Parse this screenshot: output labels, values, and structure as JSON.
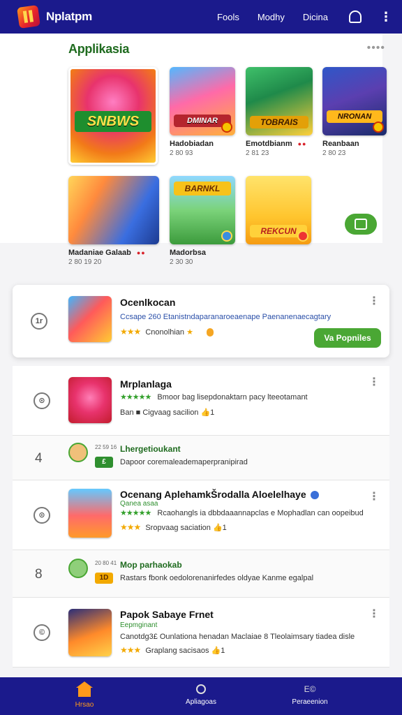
{
  "topbar": {
    "title": "Nplatpm",
    "nav": [
      "Fools",
      "Modhy",
      "Dicina"
    ],
    "logo_icon": "app-logo-icon",
    "bell_icon": "bell-icon",
    "menu_icon": "kebab-menu-icon"
  },
  "apps_section": {
    "title": "Applikasia",
    "more": "••••",
    "tiles": [
      {
        "art_text": "SNBWS",
        "name": "",
        "sub": ""
      },
      {
        "art_text": "DMINAR",
        "name": "Hadobiadan",
        "sub": "2 80 93"
      },
      {
        "art_text": "TOBRAIS",
        "name": "Emotdbianm",
        "sub": "2 81 23"
      },
      {
        "art_text": "NRONAN",
        "name": "Reanbaan",
        "sub": "2 80 23"
      },
      {
        "art_text": "",
        "name": "Madaniae Galaab",
        "sub": "2 80 19 20"
      },
      {
        "art_text": "BARNKL",
        "name": "Madorbsa",
        "sub": "2 30 30"
      },
      {
        "art_text": "REKCUN",
        "name": "",
        "sub": ""
      }
    ],
    "grab_icon": "download-box-icon"
  },
  "featured": {
    "rank": "1r",
    "title": "Ocenlkocan",
    "desc": "Ccsape 260 Etanistndaparanaroeaenape Paenanenaecagtary",
    "stars": "★★★",
    "rating_text": "Cnonolhian",
    "button": "Va Popniles"
  },
  "list": [
    {
      "rank": "⊙",
      "title": "Mrplanlaga",
      "stars": "★★★★★",
      "line1": "Bmoor bag lisepdonaktarn pacy lteeotamant",
      "line2": "Ban ■ Cigvaag sacilion 👍1"
    },
    {
      "rank": "4",
      "title": "Lhergetioukant",
      "tag": "£",
      "line1": "Dapoor coremaleademaperpranipirad",
      "tiny": "22 59 16"
    },
    {
      "rank": "⊙",
      "title": "Ocenang AplehamkŠrodalla Aloelelhaye",
      "subtitle": "Qanea asaa",
      "stars": "★★★★★",
      "line1": "Rcaohangls ia dbbdaaannapclas e Mophadlan can oopeibud",
      "line2": "Sropvaag saciation 👍1"
    },
    {
      "rank": "8",
      "title": "Mop parhaokab",
      "tag": "1D",
      "line1": "Rastars fbonk oedolorenanirfedes oldyae Kanme egalpal",
      "tiny": "20 80 41"
    },
    {
      "rank": "©",
      "title": "Papok Sabaye Frnet",
      "subtitle": "Eepmginant",
      "line1": "Canotdg3£ Ounlationa henadan Maclaiae 8 Tleolaimsary tiadea disle",
      "line2": "Graplang sacisaos 👍1",
      "stars": "★★★"
    }
  ],
  "bottom_nav": [
    {
      "label": "Hrsao",
      "icon": "home-icon"
    },
    {
      "label": "Apliagoas",
      "icon": "apps-icon"
    },
    {
      "label": "Peraeenion",
      "icon": "profile-icon",
      "top": "E©"
    }
  ],
  "colors": {
    "primary": "#1b1a8c",
    "accent": "#4aa734",
    "section_title": "#1f6b1f"
  }
}
